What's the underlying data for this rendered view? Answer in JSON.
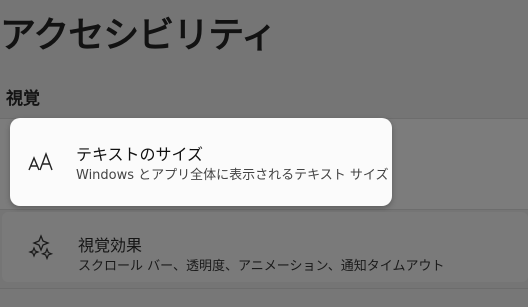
{
  "page": {
    "title": "アクセシビリティ"
  },
  "section": {
    "label": "視覚"
  },
  "items": [
    {
      "icon": "text-size-icon",
      "title": "テキストのサイズ",
      "subtitle": "Windows とアプリ全体に表示されるテキスト サイズ"
    },
    {
      "icon": "visual-effects-icon",
      "title": "視覚効果",
      "subtitle": "スクロール バー、透明度、アニメーション、通知タイムアウト"
    }
  ]
}
